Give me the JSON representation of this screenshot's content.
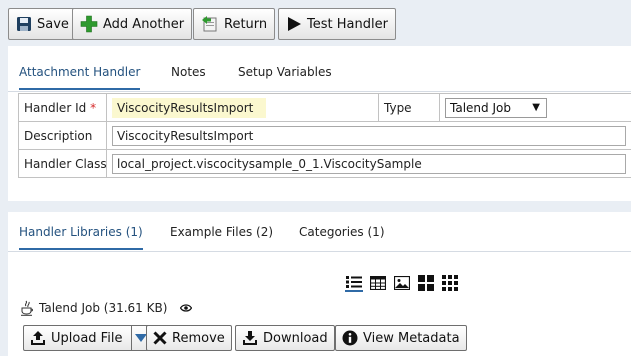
{
  "toolbar": {
    "save": "Save",
    "add_another": "Add Another",
    "return": "Return",
    "test_handler": "Test Handler"
  },
  "top_tabs": [
    "Attachment Handler",
    "Notes",
    "Setup Variables"
  ],
  "form": {
    "handler_id_label": "Handler Id",
    "required_mark": "*",
    "handler_id_value": "ViscocityResultsImport",
    "type_label": "Type",
    "type_value": "Talend Job",
    "description_label": "Description",
    "description_value": "ViscocityResultsImport",
    "handler_class_label": "Handler Class",
    "handler_class_value": "local_project.viscocitysample_0_1.ViscocitySample"
  },
  "bottom_tabs": [
    "Handler Libraries (1)",
    "Example Files (2)",
    "Categories (1)"
  ],
  "attachment": {
    "name": "Talend Job (31.61 KB)"
  },
  "actions": {
    "upload": "Upload File",
    "remove": "Remove",
    "download": "Download",
    "view_metadata": "View Metadata"
  },
  "colors": {
    "accent": "#2f6aa6",
    "green": "#2e9a2e",
    "required": "#d62a2a",
    "highlight": "#fbf8cf"
  }
}
